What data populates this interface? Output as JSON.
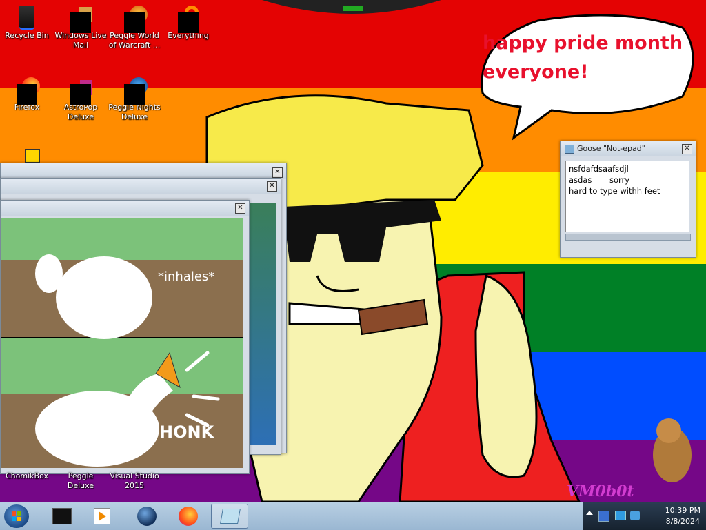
{
  "desktop": {
    "icons": [
      {
        "label": "Recycle Bin",
        "name": "recycle-bin-icon"
      },
      {
        "label": "Windows Live Mail",
        "name": "windows-live-mail-icon"
      },
      {
        "label": "Peggle World of Warcraft ...",
        "name": "peggle-wow-icon"
      },
      {
        "label": "Everything",
        "name": "everything-icon"
      },
      {
        "label": "Firefox",
        "name": "firefox-icon"
      },
      {
        "label": "AstroPop Deluxe",
        "name": "astropop-icon"
      },
      {
        "label": "Peggle Nights Deluxe",
        "name": "peggle-nights-icon"
      },
      {
        "label": "ChomikBox",
        "name": "chomikbox-icon"
      },
      {
        "label": "Peggle Deluxe",
        "name": "peggle-deluxe-icon"
      },
      {
        "label": "Visual Studio 2015",
        "name": "visual-studio-icon"
      }
    ],
    "speech_bubble": {
      "line1": "happy pride month",
      "line2": "everyone!"
    },
    "signature": "VM0b0t"
  },
  "notepad": {
    "title": "Goose \"Not-epad\"",
    "lines": [
      "nsfdafdsaafsdjl",
      "asdas       sorry",
      "hard to type withh feet"
    ]
  },
  "meme": {
    "top_caption": "*inhales*",
    "bottom_caption": "HONK"
  },
  "taskbar": {
    "items": [
      "terminal-app-icon",
      "media-player-icon",
      "globe-app-icon",
      "firefox-icon",
      "notepad-app-icon"
    ],
    "clock": {
      "time": "10:39 PM",
      "date": "8/8/2024"
    }
  }
}
